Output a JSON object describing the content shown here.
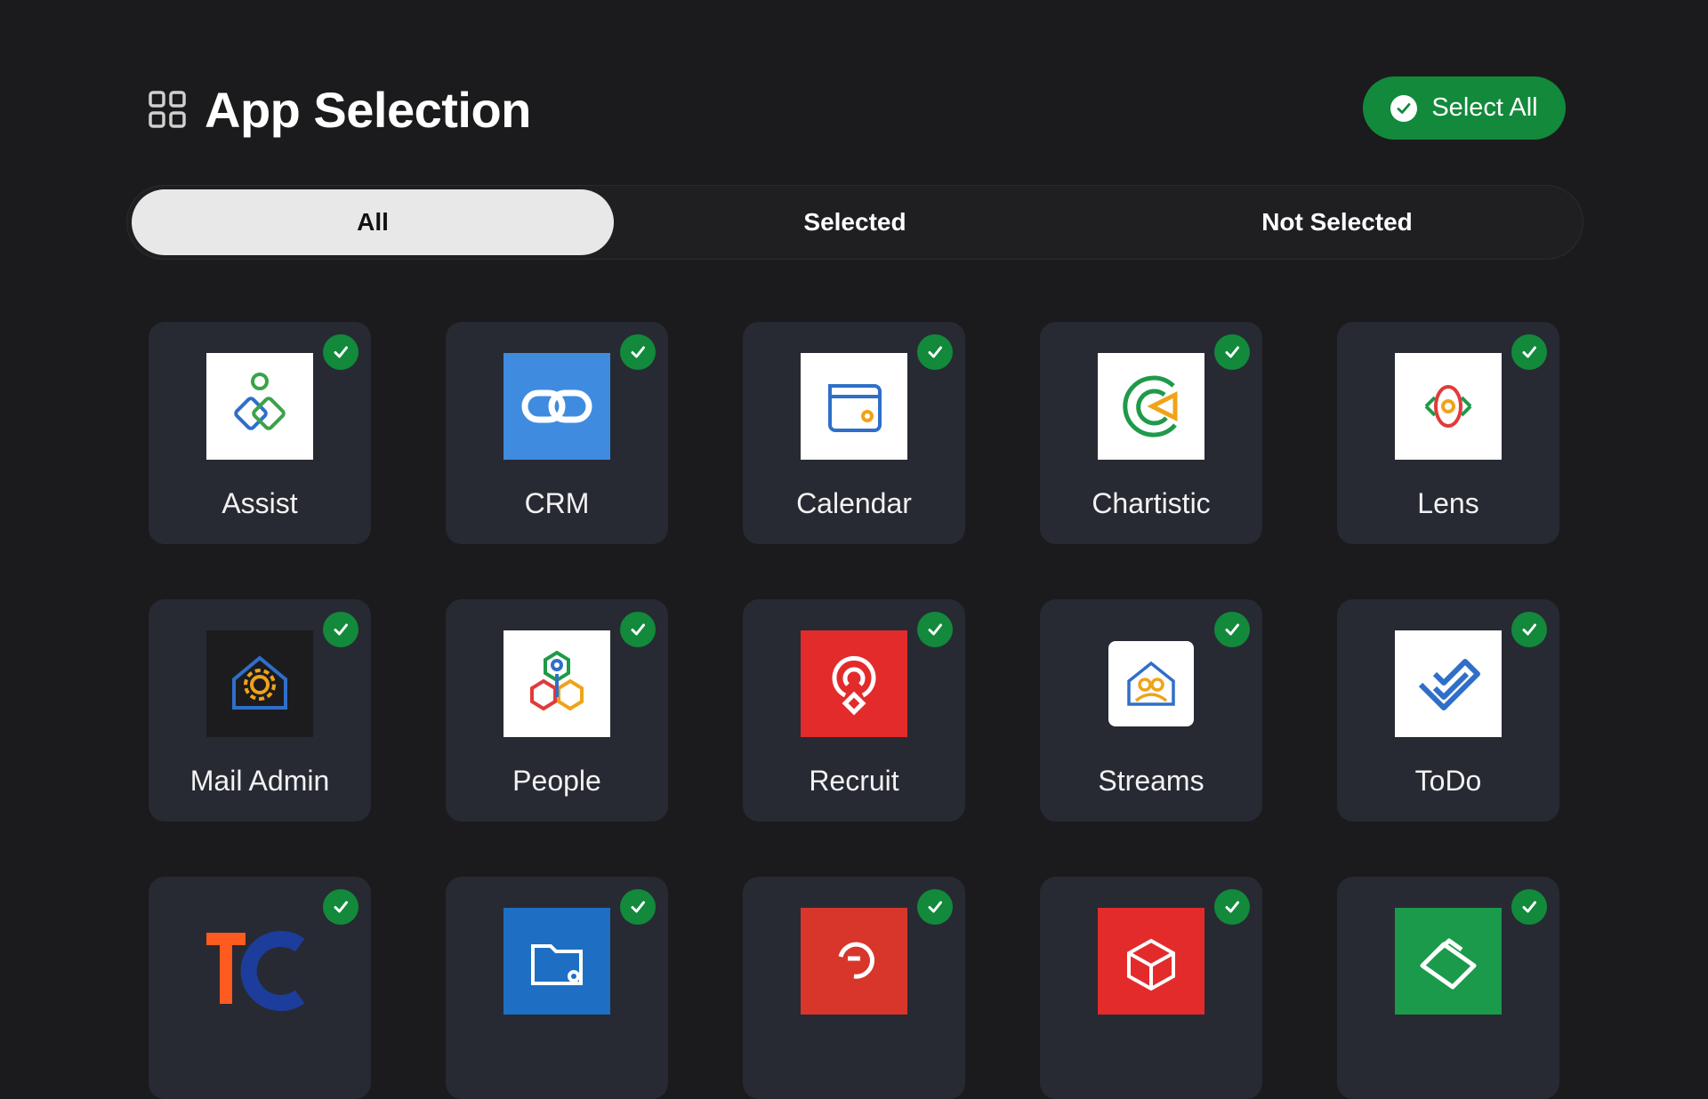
{
  "header": {
    "title": "App Selection",
    "select_all_label": "Select All"
  },
  "tabs": [
    {
      "label": "All",
      "active": true
    },
    {
      "label": "Selected",
      "active": false
    },
    {
      "label": "Not Selected",
      "active": false
    }
  ],
  "colors": {
    "accent_green": "#12893b",
    "card_bg": "#272a33",
    "page_bg": "#1b1b1d"
  },
  "apps": [
    {
      "label": "Assist",
      "icon": "assist-icon",
      "selected": true
    },
    {
      "label": "CRM",
      "icon": "crm-icon",
      "selected": true
    },
    {
      "label": "Calendar",
      "icon": "calendar-icon",
      "selected": true
    },
    {
      "label": "Chartistic",
      "icon": "chartistic-icon",
      "selected": true
    },
    {
      "label": "Lens",
      "icon": "lens-icon",
      "selected": true
    },
    {
      "label": "Mail Admin",
      "icon": "mail-admin-icon",
      "selected": true
    },
    {
      "label": "People",
      "icon": "people-icon",
      "selected": true
    },
    {
      "label": "Recruit",
      "icon": "recruit-icon",
      "selected": true
    },
    {
      "label": "Streams",
      "icon": "streams-icon",
      "selected": true
    },
    {
      "label": "ToDo",
      "icon": "todo-icon",
      "selected": true
    },
    {
      "label": "",
      "icon": "tc-icon",
      "selected": true
    },
    {
      "label": "",
      "icon": "workdrive-icon",
      "selected": true
    },
    {
      "label": "",
      "icon": "red-swirl-icon",
      "selected": true
    },
    {
      "label": "",
      "icon": "red-cube-icon",
      "selected": true
    },
    {
      "label": "",
      "icon": "green-shape-icon",
      "selected": true
    }
  ]
}
